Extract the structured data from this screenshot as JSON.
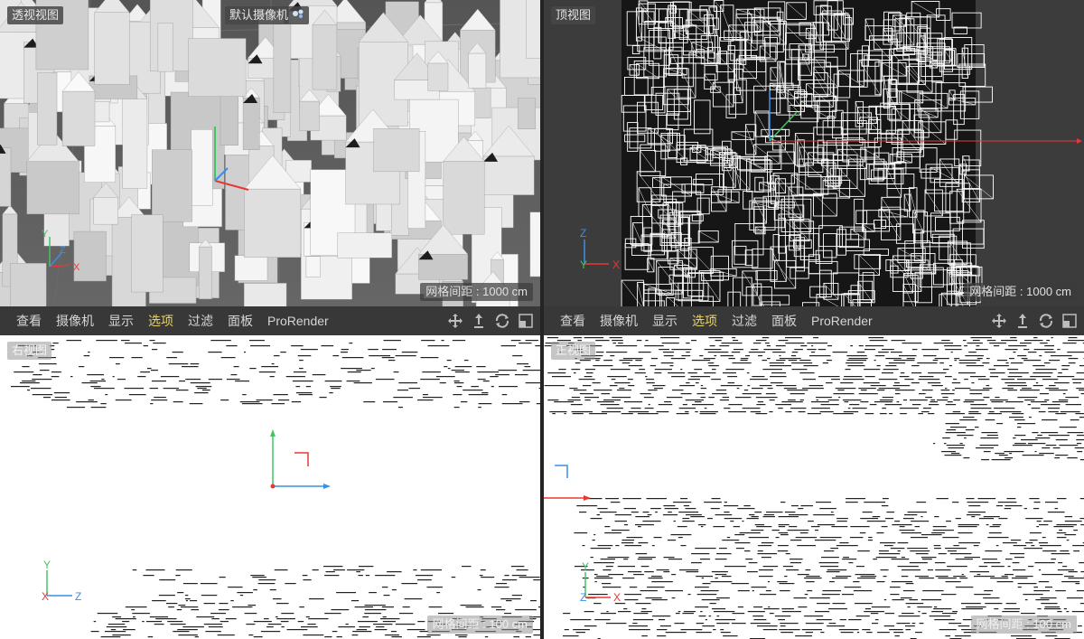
{
  "viewports": {
    "perspective": {
      "title": "透视视图",
      "camera": "默认摄像机",
      "grid_note": "网格间距 : 1000 cm"
    },
    "top": {
      "title": "顶视图",
      "grid_note": "网格间距 : 1000 cm"
    },
    "right": {
      "title": "右视图",
      "grid_note": "网格间距 : 100 cm"
    },
    "front": {
      "title": "正视图",
      "grid_note": "网格间距 : 100 cm"
    }
  },
  "menubar": {
    "items": [
      "查看",
      "摄像机",
      "显示",
      "选项",
      "过滤",
      "面板",
      "ProRender"
    ],
    "active": "选项"
  },
  "axis_labels": {
    "x": "X",
    "y": "Y",
    "z": "Z"
  },
  "colors": {
    "x_axis": "#e53935",
    "y_axis": "#43c463",
    "z_axis": "#3d8ee6",
    "active_menu": "#e9d36a"
  },
  "icons": [
    "move-icon",
    "camera-up-icon",
    "rotate-icon",
    "maximize-icon",
    "camera-gear-icon"
  ]
}
